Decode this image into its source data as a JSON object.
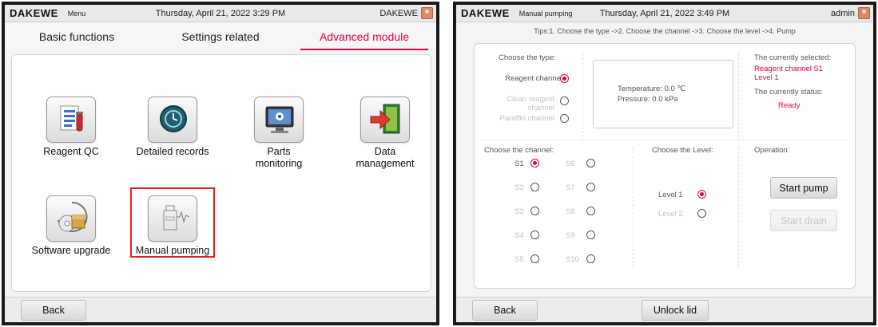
{
  "left": {
    "brand": "DAKEWE",
    "screen_name": "Menu",
    "datetime": "Thursday, April 21, 2022  3:29 PM",
    "user": "DAKEWE",
    "tabs": [
      "Basic functions",
      "Settings related",
      "Advanced module"
    ],
    "active_tab": "Advanced module",
    "apps": [
      {
        "label": "Reagent QC",
        "icon": "reagent-qc-icon"
      },
      {
        "label": "Detailed records",
        "icon": "records-icon"
      },
      {
        "label": "Parts\nmonitoring",
        "icon": "monitor-icon"
      },
      {
        "label": "Data\nmanagement",
        "icon": "data-exit-icon"
      },
      {
        "label": "Software upgrade",
        "icon": "software-upgrade-icon"
      },
      {
        "label": "Manual pumping",
        "icon": "manual-pumping-icon"
      }
    ],
    "highlighted_app": "Manual pumping",
    "back_label": "Back"
  },
  "right": {
    "brand": "DAKEWE",
    "screen_name": "Manual pumping",
    "datetime": "Thursday, April 21, 2022  3:49 PM",
    "user": "admin",
    "tips": "Tips:1. Choose the type ->2. Choose the channel ->3. Choose the level ->4. Pump",
    "type_heading": "Choose the type:",
    "types": [
      {
        "label": "Reagent channel",
        "selected": true,
        "enabled": true
      },
      {
        "label": "Clean reagent\nchannel",
        "selected": false,
        "enabled": false
      },
      {
        "label": "Paraffin channel",
        "selected": false,
        "enabled": false
      }
    ],
    "temperature": "Temperature: 0.0 ℃",
    "pressure": "Pressure: 0.0 kPa",
    "selected_heading": "The currently selected:",
    "selected_value": "Reagent channel S1\nLevel 1",
    "status_heading": "The currently status:",
    "status_value": "Ready",
    "channel_heading": "Choose the channel:",
    "channels": [
      {
        "label": "S1",
        "selected": true,
        "enabled": true
      },
      {
        "label": "S2",
        "selected": false,
        "enabled": false
      },
      {
        "label": "S3",
        "selected": false,
        "enabled": false
      },
      {
        "label": "S4",
        "selected": false,
        "enabled": false
      },
      {
        "label": "S5",
        "selected": false,
        "enabled": false
      },
      {
        "label": "S6",
        "selected": false,
        "enabled": false
      },
      {
        "label": "S7",
        "selected": false,
        "enabled": false
      },
      {
        "label": "S8",
        "selected": false,
        "enabled": false
      },
      {
        "label": "S9",
        "selected": false,
        "enabled": false
      },
      {
        "label": "S10",
        "selected": false,
        "enabled": false
      }
    ],
    "level_heading": "Choose the Level:",
    "levels": [
      {
        "label": "Level 1",
        "selected": true,
        "enabled": true
      },
      {
        "label": "Level 2",
        "selected": false,
        "enabled": false
      }
    ],
    "operation_heading": "Operation:",
    "start_pump_label": "Start pump",
    "start_drain_label": "Start drain",
    "back_label": "Back",
    "unlock_label": "Unlock lid"
  },
  "colors": {
    "accent": "#e5004f",
    "highlight_box": "#e02020",
    "disabled_text": "#c4c4c4"
  }
}
